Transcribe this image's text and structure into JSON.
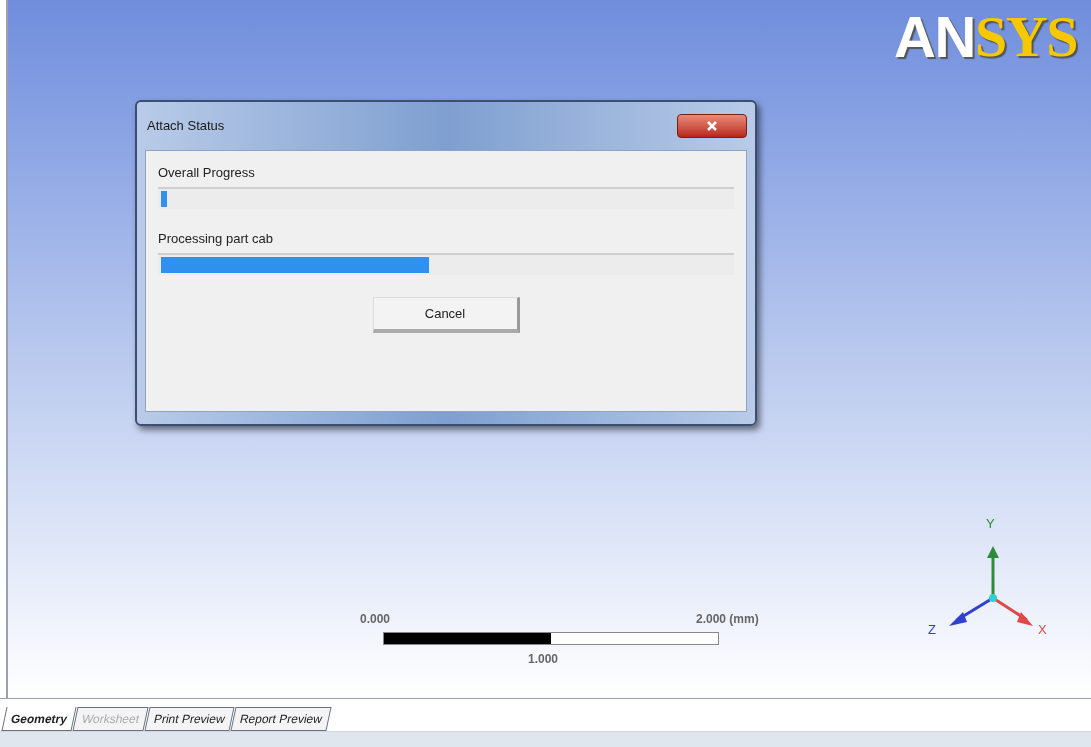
{
  "logo": {
    "parts": [
      {
        "text": "AN"
      },
      {
        "text": "SYS"
      }
    ]
  },
  "dialog": {
    "title": "Attach Status",
    "progress": [
      {
        "label": "Overall Progress",
        "level": 0.01
      },
      {
        "label": "Processing part cab",
        "level": 0.47
      }
    ],
    "buttons": [
      "Cancel"
    ]
  },
  "scale_bar": {
    "start": "0.000",
    "middle": "1.000",
    "end": "2.000 (mm)"
  },
  "triad": {
    "axes": [
      {
        "kind": "y",
        "label": "Y"
      },
      {
        "kind": "x",
        "label": "X"
      },
      {
        "kind": "z",
        "label": "Z"
      }
    ]
  },
  "tabs": [
    {
      "label": "Geometry",
      "selected": true,
      "disabled": false
    },
    {
      "label": "Worksheet",
      "selected": false,
      "disabled": true
    },
    {
      "label": "Print Preview",
      "selected": false,
      "disabled": false
    },
    {
      "label": "Report Preview",
      "selected": false,
      "disabled": false
    }
  ]
}
